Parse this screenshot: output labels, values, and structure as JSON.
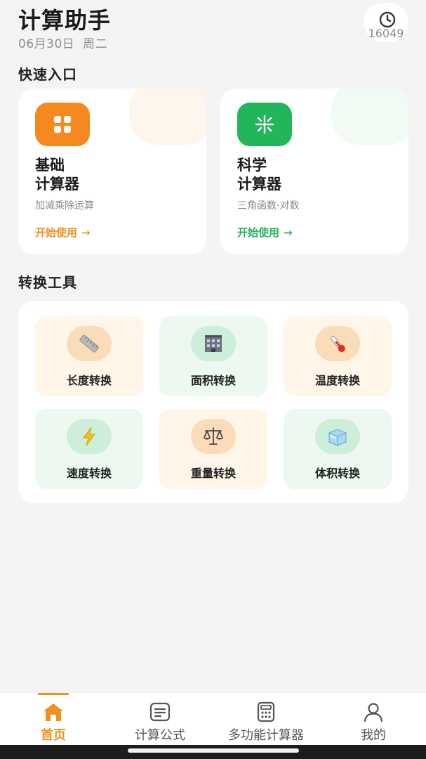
{
  "header": {
    "title": "计算助手",
    "date": "06月30日",
    "weekday": "周二",
    "history_icon": "history-clock-icon",
    "history_count": "16049"
  },
  "quick_access": {
    "title": "快速入口",
    "cards": [
      {
        "icon": "grid-icon",
        "name_line1": "基础",
        "name_line2": "计算器",
        "desc": "加减乘除运算",
        "action": "开始使用",
        "action_icon": "→",
        "accent": "#f48a1f"
      },
      {
        "icon": "sparkle-icon",
        "name_line1": "科学",
        "name_line2": "计算器",
        "desc": "三角函数·对数",
        "action": "开始使用",
        "action_icon": "→",
        "accent": "#22b65a"
      }
    ]
  },
  "tools": {
    "title": "转换工具",
    "items": [
      {
        "label": "长度转换",
        "icon": "ruler-icon"
      },
      {
        "label": "面积转换",
        "icon": "building-icon"
      },
      {
        "label": "温度转换",
        "icon": "thermometer-icon"
      },
      {
        "label": "速度转换",
        "icon": "lightning-icon"
      },
      {
        "label": "重量转换",
        "icon": "scale-icon"
      },
      {
        "label": "体积转换",
        "icon": "cube-icon"
      }
    ]
  },
  "nav": {
    "items": [
      {
        "label": "首页",
        "icon": "home-icon",
        "active": true
      },
      {
        "label": "计算公式",
        "icon": "formula-icon",
        "active": false
      },
      {
        "label": "多功能计算器",
        "icon": "calculator-icon",
        "active": false
      },
      {
        "label": "我的",
        "icon": "user-icon",
        "active": false
      }
    ],
    "accent": "#f0901e"
  }
}
